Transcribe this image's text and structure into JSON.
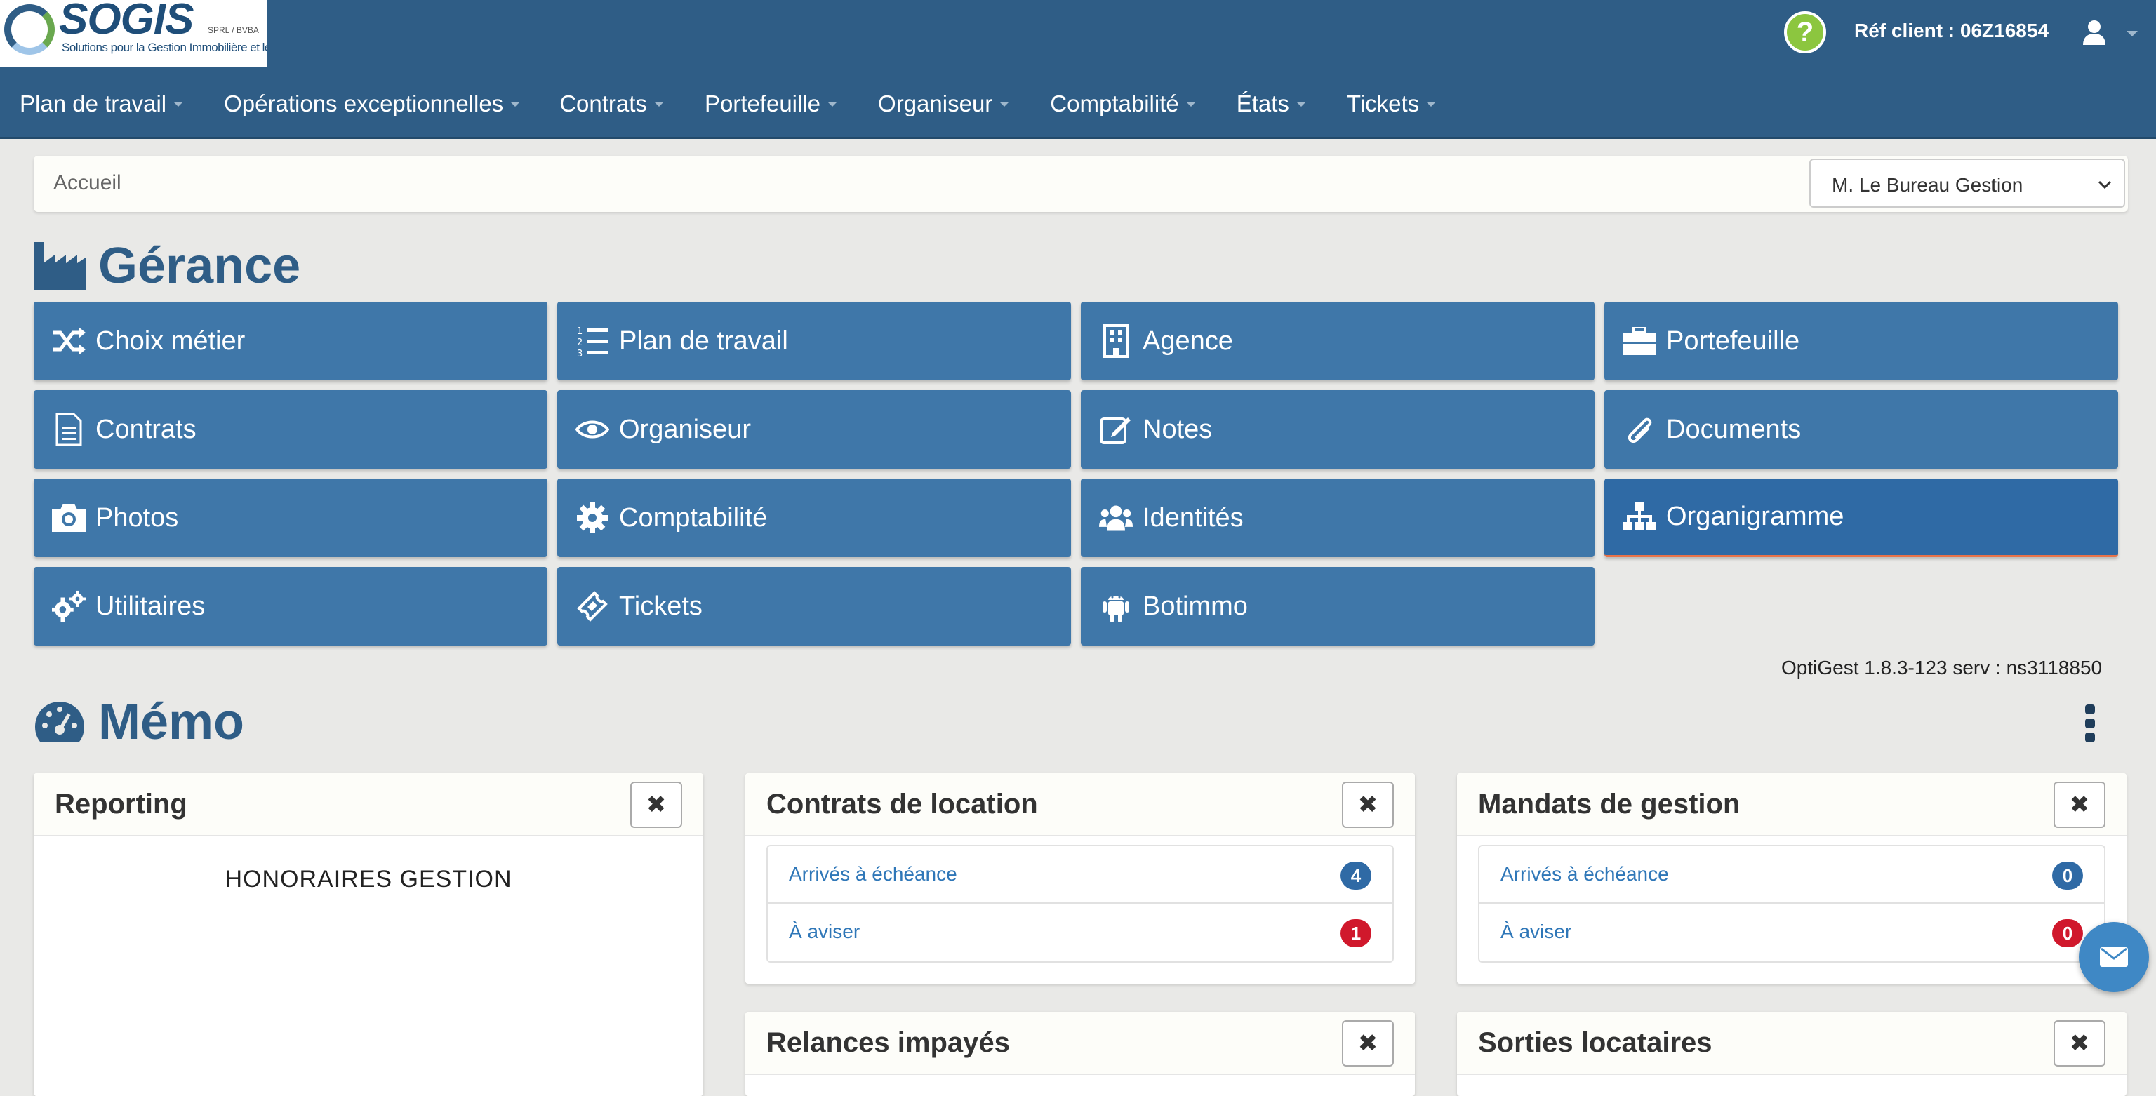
{
  "brand": {
    "logo_text": "SOGIS",
    "logo_tag": "SPRL / BVBA",
    "logo_subtitle": "Solutions pour la Gestion Immobilière et le Syndic"
  },
  "header": {
    "ref_client": "Réf client : 06Z16854",
    "help_icon": "question-circle-icon",
    "user_icon": "user-icon"
  },
  "nav": {
    "items": [
      {
        "label": "Plan de travail"
      },
      {
        "label": "Opérations exceptionnelles"
      },
      {
        "label": "Contrats"
      },
      {
        "label": "Portefeuille"
      },
      {
        "label": "Organiseur"
      },
      {
        "label": "Comptabilité"
      },
      {
        "label": "États"
      },
      {
        "label": "Tickets"
      }
    ]
  },
  "breadcrumb": {
    "current": "Accueil",
    "select_value": "M. Le Bureau Gestion"
  },
  "gerance": {
    "title": "Gérance",
    "tiles": [
      {
        "label": "Choix métier",
        "icon": "shuffle-icon"
      },
      {
        "label": "Plan de travail",
        "icon": "list-ol-icon"
      },
      {
        "label": "Agence",
        "icon": "building-icon"
      },
      {
        "label": "Portefeuille",
        "icon": "briefcase-icon"
      },
      {
        "label": "Contrats",
        "icon": "file-text-icon"
      },
      {
        "label": "Organiseur",
        "icon": "eye-icon"
      },
      {
        "label": "Notes",
        "icon": "edit-icon"
      },
      {
        "label": "Documents",
        "icon": "paperclip-icon"
      },
      {
        "label": "Photos",
        "icon": "camera-icon"
      },
      {
        "label": "Comptabilité",
        "icon": "cog-icon"
      },
      {
        "label": "Identités",
        "icon": "users-icon"
      },
      {
        "label": "Organigramme",
        "icon": "sitemap-icon"
      },
      {
        "label": "Utilitaires",
        "icon": "cogs-icon"
      },
      {
        "label": "Tickets",
        "icon": "ticket-icon"
      },
      {
        "label": "Botimmo",
        "icon": "android-icon"
      }
    ]
  },
  "version": "OptiGest 1.8.3-123 serv : ns3118850",
  "memo": {
    "title": "Mémo",
    "panels": {
      "reporting": {
        "title": "Reporting",
        "chart_title": "HONORAIRES GESTION"
      },
      "contrats_location": {
        "title": "Contrats de location",
        "items": [
          {
            "label": "Arrivés à échéance",
            "count": "4"
          },
          {
            "label": "À aviser",
            "count": "1"
          }
        ]
      },
      "mandats_gestion": {
        "title": "Mandats de gestion",
        "items": [
          {
            "label": "Arrivés à échéance",
            "count": "0"
          },
          {
            "label": "À aviser",
            "count": "0"
          }
        ]
      },
      "relances_impayes": {
        "title": "Relances impayés"
      },
      "sorties_locataires": {
        "title": "Sorties locataires"
      }
    },
    "close_glyph": "✖"
  },
  "colors": {
    "header": "#2f5d86",
    "tile": "#3f77a9",
    "badge_blue": "#2f6aa5",
    "badge_red": "#d0182c",
    "link": "#2f77b8"
  }
}
